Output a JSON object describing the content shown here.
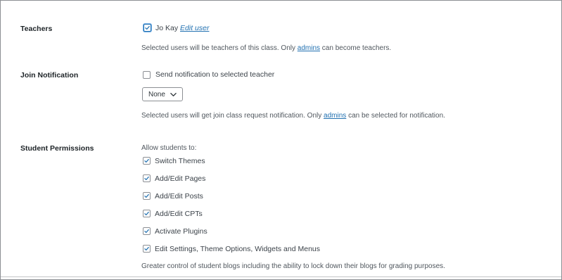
{
  "teachers": {
    "label": "Teachers",
    "user_name": "Jo Kay",
    "edit_link": "Edit user",
    "desc_before": "Selected users will be teachers of this class. Only",
    "desc_link": "admins",
    "desc_after": "can become teachers."
  },
  "join_notification": {
    "label": "Join Notification",
    "checkbox_label": "Send notification to selected teacher",
    "select_value": "None",
    "desc_before": "Selected users will get join class request notification. Only",
    "desc_link": "admins",
    "desc_after": "can be selected for notification."
  },
  "student_permissions": {
    "label": "Student Permissions",
    "intro": "Allow students to:",
    "options": [
      {
        "label": "Switch Themes",
        "checked": true
      },
      {
        "label": "Add/Edit Pages",
        "checked": true
      },
      {
        "label": "Add/Edit Posts",
        "checked": true
      },
      {
        "label": "Add/Edit CPTs",
        "checked": true
      },
      {
        "label": "Activate Plugins",
        "checked": true
      },
      {
        "label": "Edit Settings, Theme Options, Widgets and Menus",
        "checked": true
      }
    ],
    "note": "Greater control of student blogs including the ability to lock down their blogs for grading purposes."
  },
  "colors": {
    "accent": "#2271b1",
    "text": "#1d2327",
    "muted": "#50575e",
    "border": "#8c8f94"
  },
  "icons": {
    "check": "check-icon",
    "chevron": "chevron-down-icon"
  }
}
